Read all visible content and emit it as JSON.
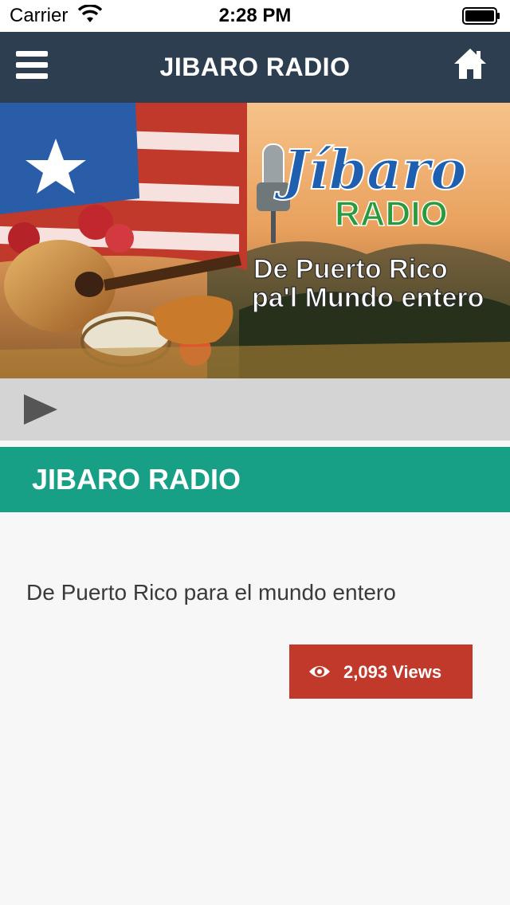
{
  "status_bar": {
    "carrier": "Carrier",
    "time": "2:28 PM",
    "icons": [
      "wifi-icon",
      "battery-icon"
    ]
  },
  "navbar": {
    "title": "JIBARO RADIO",
    "menu_icon": "hamburger-menu-icon",
    "home_icon": "home-icon",
    "background": "#2c3e50"
  },
  "banner": {
    "logo_script": "Jíbaro",
    "logo_word": "RADIO",
    "tagline_line1": "De Puerto Rico",
    "tagline_line2": "pa'l Mundo entero"
  },
  "player": {
    "play_icon": "play-icon",
    "background": "#d4d4d4"
  },
  "station": {
    "title": "JIBARO RADIO",
    "title_background": "#17a085",
    "description": "De Puerto Rico para el mundo entero"
  },
  "views": {
    "label": "2,093 Views",
    "icon": "eye-icon",
    "background": "#c0392b"
  }
}
